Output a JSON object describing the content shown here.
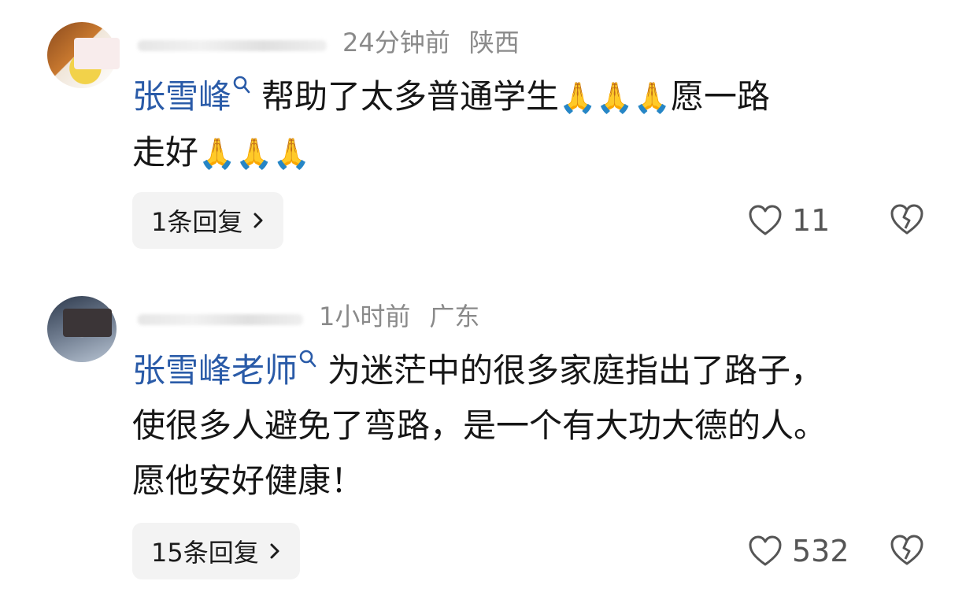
{
  "comments": [
    {
      "time": "24分钟前",
      "location": "陕西",
      "mention": "张雪峰",
      "text_line1": "帮助了太多普通学生",
      "pray_a": "🙏🙏🙏",
      "text_line1b": "愿一路",
      "text_line2": "走好",
      "pray_b": "🙏🙏🙏",
      "reply_label": "1条回复",
      "like_count": "11"
    },
    {
      "time": "1小时前",
      "location": "广东",
      "mention": "张雪峰老师",
      "text_line1": "为迷茫中的很多家庭指出了路子，",
      "text_line2": "使很多人避免了弯路，是一个有大功大德的人。",
      "text_line3": "愿他安好健康！",
      "reply_label": "15条回复",
      "like_count": "532"
    }
  ],
  "icons": {
    "search": "search-icon",
    "heart": "heart-icon",
    "broken_heart": "broken-heart-icon",
    "chevron": "chevron-right-icon"
  },
  "colors": {
    "mention": "#2a5ba8",
    "meta": "#8a8a8a",
    "reply_bg": "#f3f3f3"
  }
}
